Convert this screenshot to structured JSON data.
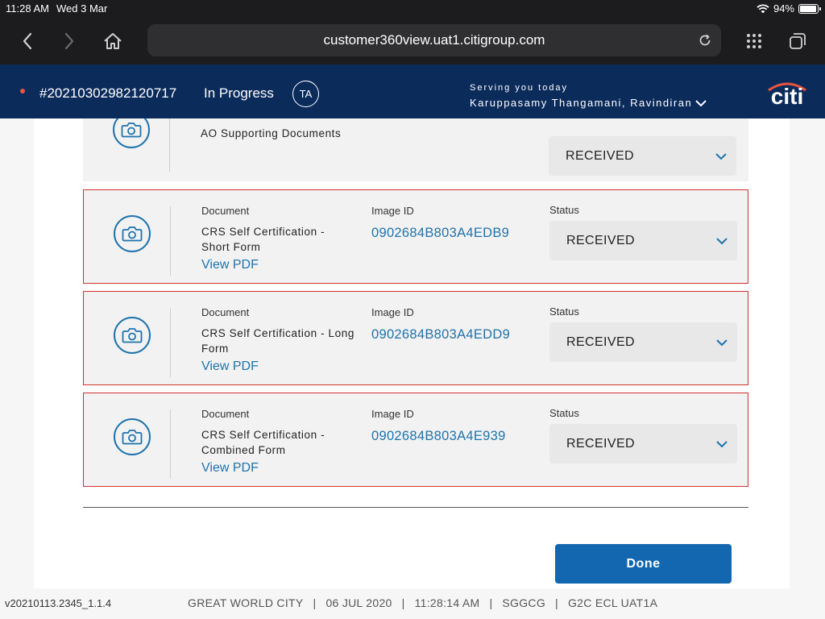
{
  "status_bar": {
    "time": "11:28 AM",
    "date": "Wed 3 Mar",
    "battery": "94%",
    "battery_level": 0.94
  },
  "browser": {
    "url": "customer360view.uat1.citigroup.com"
  },
  "header": {
    "case_number": "#20210302982120717",
    "case_status": "In Progress",
    "initials": "TA",
    "serving_label": "Serving you today",
    "agent_name": "Karuppasamy Thangamani, Ravindiran",
    "logo_text": "citi"
  },
  "labels": {
    "document": "Document",
    "image_id": "Image ID",
    "status": "Status",
    "view_pdf": "View PDF"
  },
  "partial_doc": {
    "name": "AO Supporting Documents",
    "status": "RECEIVED"
  },
  "documents": [
    {
      "name_line1": "CRS Self Certification -",
      "name_line2": "Short Form",
      "image_id": "0902684B803A4EDB9",
      "status": "RECEIVED"
    },
    {
      "name_line1": "CRS Self Certification - Long",
      "name_line2": "Form",
      "image_id": "0902684B803A4EDD9",
      "status": "RECEIVED"
    },
    {
      "name_line1": "CRS Self Certification -",
      "name_line2": "Combined Form",
      "image_id": "0902684B803A4E939",
      "status": "RECEIVED"
    }
  ],
  "actions": {
    "done": "Done"
  },
  "footer": {
    "version": "v20210113.2345_1.1.4",
    "branch": "GREAT WORLD CITY",
    "date": "06 JUL 2020",
    "time": "11:28:14 AM",
    "region": "SGGCG",
    "env": "G2C ECL UAT1A",
    "separator": "|"
  },
  "colors": {
    "header_bg": "#0b2b5b",
    "accent": "#1e73ad",
    "flag_border": "#d0322d",
    "primary_button": "#1267b0"
  }
}
